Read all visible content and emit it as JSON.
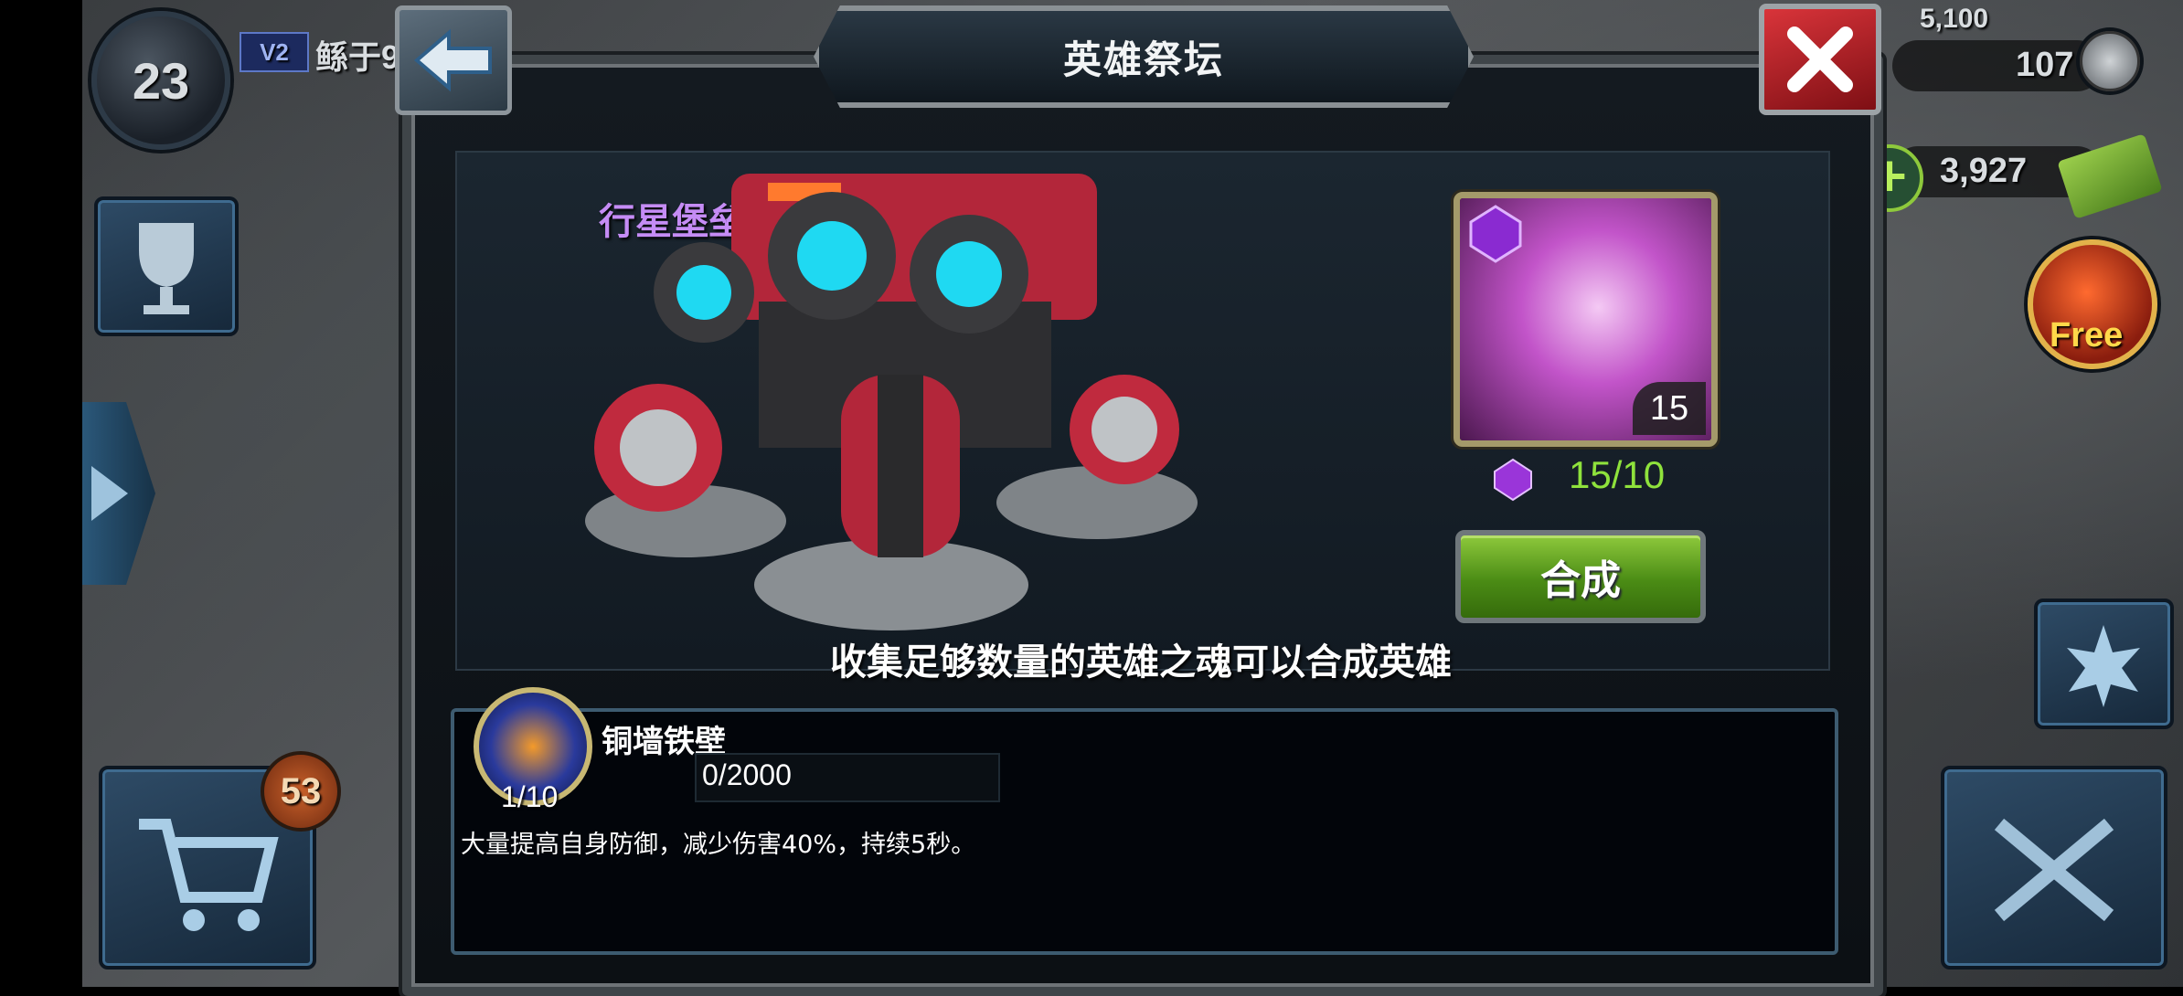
{
  "hud": {
    "player_level": "23",
    "vip_label": "V2",
    "player_name": "鲧于9",
    "cap_text": "5,100",
    "resource_1": "107",
    "resource_2": "3,927",
    "free_label": "Free",
    "cart_badge": "53"
  },
  "dialog": {
    "title": "英雄祭坛",
    "hero_name": "行星堡垒",
    "card_level": "15",
    "soul_count": "15/10",
    "compose_label": "合成",
    "hint": "收集足够数量的英雄之魂可以合成英雄"
  },
  "skill": {
    "name": "铜墙铁壁",
    "exp": "0/2000",
    "level": "1/10",
    "description": "大量提高自身防御，减少伤害40%，持续5秒。"
  },
  "colors": {
    "hero_name": "#c58cf5",
    "soul_count": "#8fe23c",
    "compose_button": "#5a9a1e",
    "close_button": "#c8262c"
  }
}
